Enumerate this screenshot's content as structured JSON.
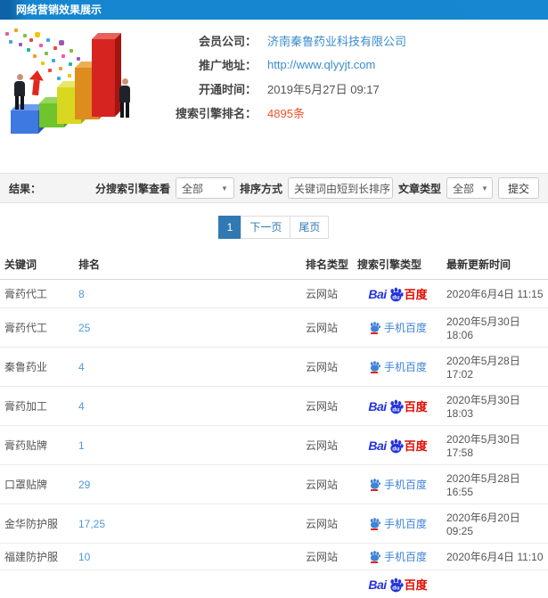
{
  "header": {
    "title": "网络营销效果展示"
  },
  "info": {
    "fields": [
      {
        "label": "会员公司：",
        "value": "济南秦鲁药业科技有限公司"
      },
      {
        "label": "推广地址：",
        "value": "http://www.qlyyjt.com"
      },
      {
        "label": "开通时间：",
        "value": "2019年5月27日 09:17"
      },
      {
        "label": "搜索引擎排名：",
        "value": "4895条"
      }
    ]
  },
  "results": {
    "label": "结果：",
    "filters": [
      {
        "label": "分搜索引擎查看",
        "value": "全部"
      },
      {
        "label": "排序方式",
        "value": "关键词由短到长排序"
      },
      {
        "label": "文章类型",
        "value": "全部"
      }
    ],
    "submit_label": "提交"
  },
  "pagination": {
    "items": [
      {
        "label": "1",
        "active": true
      },
      {
        "label": "下一页",
        "active": false
      },
      {
        "label": "尾页",
        "active": false
      }
    ]
  },
  "table": {
    "headers": [
      "关键词",
      "排名",
      "排名类型",
      "搜索引擎类型",
      "最新更新时间"
    ],
    "engines": {
      "baidu": {
        "bai": "Bai",
        "du": "du",
        "name": "百度"
      },
      "mobile": {
        "name": "手机百度"
      }
    },
    "rows": [
      {
        "keyword": "膏药代工",
        "rank": "8",
        "rank_type": "云网站",
        "engine": "baidu",
        "time": "2020年6月4日 11:15"
      },
      {
        "keyword": "膏药代工",
        "rank": "25",
        "rank_type": "云网站",
        "engine": "mobile",
        "time": "2020年5月30日 18:06"
      },
      {
        "keyword": "秦鲁药业",
        "rank": "4",
        "rank_type": "云网站",
        "engine": "mobile",
        "time": "2020年5月28日 17:02"
      },
      {
        "keyword": "膏药加工",
        "rank": "4",
        "rank_type": "云网站",
        "engine": "baidu",
        "time": "2020年5月30日 18:03"
      },
      {
        "keyword": "膏药贴牌",
        "rank": "1",
        "rank_type": "云网站",
        "engine": "baidu",
        "time": "2020年5月30日 17:58"
      },
      {
        "keyword": "口罩贴牌",
        "rank": "29",
        "rank_type": "云网站",
        "engine": "mobile",
        "time": "2020年5月28日 16:55"
      },
      {
        "keyword": "金华防护服",
        "rank": "17,25",
        "rank_type": "云网站",
        "engine": "mobile",
        "time": "2020年6月20日 09:25"
      },
      {
        "keyword": "福建防护服",
        "rank": "10",
        "rank_type": "云网站",
        "engine": "mobile",
        "time": "2020年6月4日 11:10"
      },
      {
        "keyword": "",
        "rank": "",
        "rank_type": "",
        "engine": "baidu",
        "time": "",
        "partial": true
      }
    ]
  }
}
